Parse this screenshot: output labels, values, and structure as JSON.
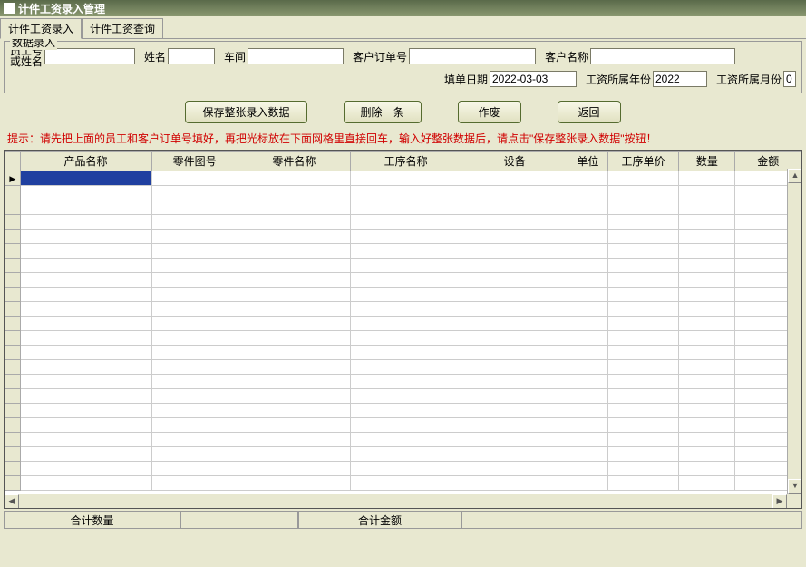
{
  "window": {
    "title": "计件工资录入管理"
  },
  "tabs": [
    {
      "label": "计件工资录入",
      "active": true
    },
    {
      "label": "计件工资查询",
      "active": false
    }
  ],
  "fieldset": {
    "legend": "数据录入"
  },
  "form": {
    "emp_label_top": "员工号",
    "emp_label_bot": "或姓名",
    "emp_value": "",
    "name_label": "姓名",
    "name_value": "",
    "workshop_label": "车间",
    "workshop_value": "",
    "order_label": "客户订单号",
    "order_value": "",
    "customer_label": "客户名称",
    "customer_value": "",
    "date_label": "填单日期",
    "date_value": "2022-03-03",
    "year_label": "工资所属年份",
    "year_value": "2022",
    "month_label": "工资所属月份",
    "month_value": "0"
  },
  "buttons": {
    "save": "保存整张录入数据",
    "delete": "删除一条",
    "void": "作废",
    "back": "返回"
  },
  "hint": "提示：请先把上面的员工和客户订单号填好，再把光标放在下面网格里直接回车，输入好整张数据后，请点击\"保存整张录入数据\"按钮！",
  "grid": {
    "columns": [
      {
        "label": "产品名称",
        "w": 140
      },
      {
        "label": "零件图号",
        "w": 92
      },
      {
        "label": "零件名称",
        "w": 120
      },
      {
        "label": "工序名称",
        "w": 118
      },
      {
        "label": "设备",
        "w": 114
      },
      {
        "label": "单位",
        "w": 42
      },
      {
        "label": "工序单价",
        "w": 76
      },
      {
        "label": "数量",
        "w": 60
      },
      {
        "label": "金额",
        "w": 70
      }
    ],
    "row_count": 22
  },
  "footer": {
    "qty_label": "合计数量",
    "amount_label": "合计金额"
  }
}
